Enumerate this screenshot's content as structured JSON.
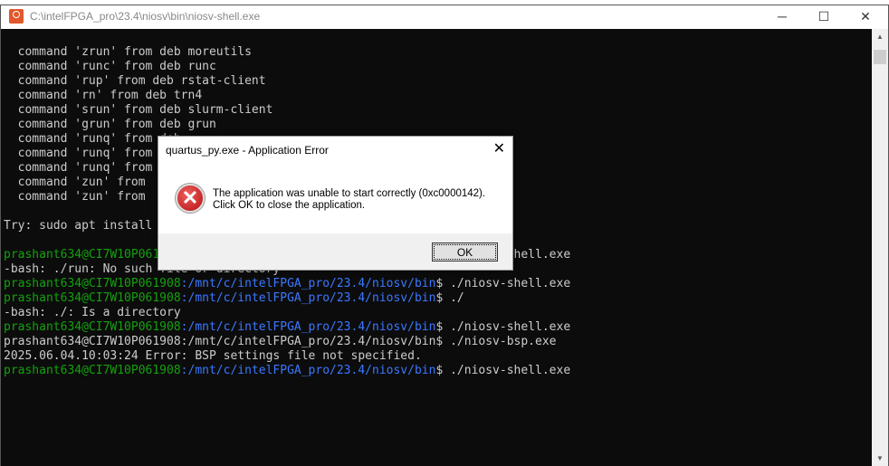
{
  "window": {
    "title": "C:\\intelFPGA_pro\\23.4\\niosv\\bin\\niosv-shell.exe",
    "minimize": "─",
    "maximize": "☐",
    "close": "✕"
  },
  "terminal": {
    "lines": [
      {
        "plain": "  command 'zrun' from deb moreutils"
      },
      {
        "plain": "  command 'runc' from deb runc"
      },
      {
        "plain": "  command 'rup' from deb rstat-client"
      },
      {
        "plain": "  command 'rn' from deb trn4"
      },
      {
        "plain": "  command 'srun' from deb slurm-client"
      },
      {
        "plain": "  command 'grun' from deb grun"
      },
      {
        "plain": "  command 'runq' from deb"
      },
      {
        "plain": "  command 'runq' from"
      },
      {
        "plain": "  command 'runq' from"
      },
      {
        "plain": "  command 'zun' from"
      },
      {
        "plain": "  command 'zun' from"
      },
      {
        "plain": ""
      },
      {
        "plain": "Try: sudo apt install"
      },
      {
        "plain": ""
      },
      {
        "user": "prashant634@CI7W10P061908",
        "path": ":/mnt/c/intelFPGA_pro/23.4/niosv/bin",
        "cmd": "$ ./niosv-shell.exe"
      },
      {
        "plain": "-bash: ./run: No such file or directory"
      },
      {
        "user": "prashant634@CI7W10P061908",
        "path": ":/mnt/c/intelFPGA_pro/23.4/niosv/bin",
        "cmd": "$ ./niosv-shell.exe"
      },
      {
        "user": "prashant634@CI7W10P061908",
        "path": ":/mnt/c/intelFPGA_pro/23.4/niosv/bin",
        "cmd": "$ ./"
      },
      {
        "plain": "-bash: ./: Is a directory"
      },
      {
        "user": "prashant634@CI7W10P061908",
        "path": ":/mnt/c/intelFPGA_pro/23.4/niosv/bin",
        "cmd": "$ ./niosv-shell.exe"
      },
      {
        "plain": "prashant634@CI7W10P061908:/mnt/c/intelFPGA_pro/23.4/niosv/bin$ ./niosv-bsp.exe"
      },
      {
        "plain": "2025.06.04.10:03:24 Error: BSP settings file not specified."
      },
      {
        "user": "prashant634@CI7W10P061908",
        "path": ":/mnt/c/intelFPGA_pro/23.4/niosv/bin",
        "cmd": "$ ./niosv-shell.exe"
      }
    ]
  },
  "dialog": {
    "title": "quartus_py.exe - Application Error",
    "close": "✕",
    "message_line1": "The application was unable to start correctly (0xc0000142).",
    "message_line2": "Click OK to close the application.",
    "ok_label": "OK",
    "icon": "error-icon"
  }
}
